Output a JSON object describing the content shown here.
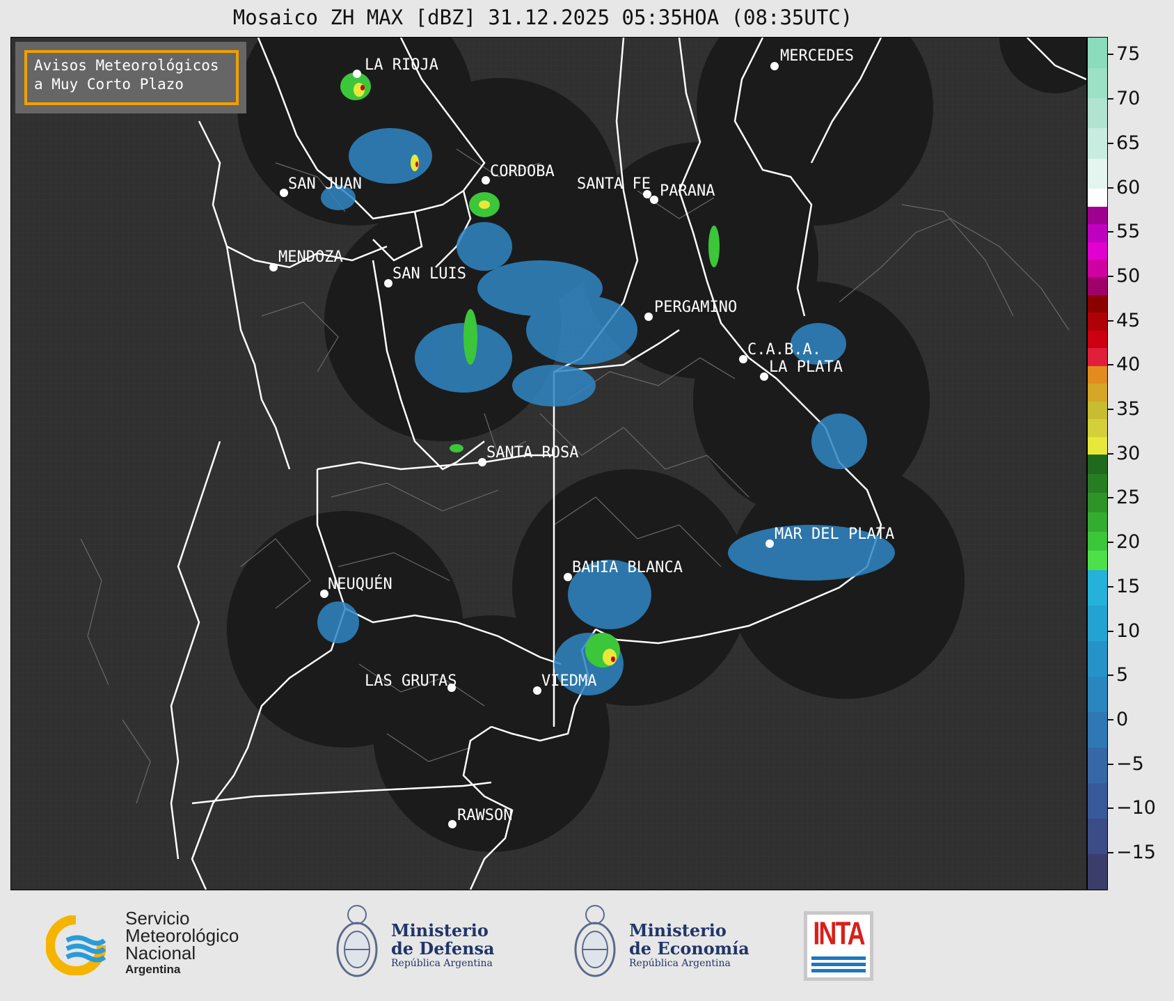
{
  "title": "Mosaico ZH MAX [dBZ] 31.12.2025 05:35HOA (08:35UTC)",
  "avisos": {
    "line1": "Avisos Meteorológicos",
    "line2": "a Muy Corto Plazo",
    "border_color": "#f0a000"
  },
  "cities": [
    {
      "name": "LA RIOJA"
    },
    {
      "name": "MERCEDES"
    },
    {
      "name": "SAN JUAN"
    },
    {
      "name": "CORDOBA"
    },
    {
      "name": "SANTA FE"
    },
    {
      "name": "PARANA"
    },
    {
      "name": "MENDOZA"
    },
    {
      "name": "SAN LUIS"
    },
    {
      "name": "PERGAMINO"
    },
    {
      "name": "C.A.B.A."
    },
    {
      "name": "LA PLATA"
    },
    {
      "name": "SANTA ROSA"
    },
    {
      "name": "MAR DEL PLATA"
    },
    {
      "name": "BAHIA BLANCA"
    },
    {
      "name": "NEUQUÉN"
    },
    {
      "name": "LAS GRUTAS"
    },
    {
      "name": "VIEDMA"
    },
    {
      "name": "RAWSON"
    }
  ],
  "colorbar": {
    "unit": "dBZ",
    "min": -19,
    "max": 77,
    "tick_labels": [
      "75",
      "70",
      "65",
      "60",
      "55",
      "50",
      "45",
      "40",
      "35",
      "30",
      "25",
      "20",
      "15",
      "10",
      "5",
      "0",
      "−5",
      "−10",
      "−15"
    ],
    "tick_values": [
      75,
      70,
      65,
      60,
      55,
      50,
      45,
      40,
      35,
      30,
      25,
      20,
      15,
      10,
      5,
      0,
      -5,
      -10,
      -15
    ],
    "segments": [
      {
        "from": -19,
        "to": 17,
        "colors": [
          "#3b3e6b",
          "#3c4c86",
          "#395a99",
          "#3668a8",
          "#2f78b4",
          "#2a86bf",
          "#2693c8",
          "#23a3d2",
          "#24b2da"
        ]
      },
      {
        "from": 17,
        "to": 30,
        "colors": [
          "#4ee04a",
          "#3cc63a",
          "#34ac30",
          "#2e9428",
          "#277e22",
          "#1f6a1c"
        ]
      },
      {
        "from": 30,
        "to": 40,
        "colors": [
          "#e8e83a",
          "#d4d03a",
          "#c8bc30",
          "#d6a626",
          "#e28c1e"
        ]
      },
      {
        "from": 40,
        "to": 50,
        "colors": [
          "#e0203a",
          "#cc0010",
          "#b00008",
          "#8c0000",
          "#a0006a"
        ]
      },
      {
        "from": 50,
        "to": 58,
        "colors": [
          "#d000a0",
          "#e000d0",
          "#c000c0",
          "#a00090"
        ]
      },
      {
        "from": 58,
        "to": 60,
        "colors": [
          "#ffffff"
        ]
      },
      {
        "from": 60,
        "to": 77,
        "colors": [
          "#e4f4ee",
          "#c8ecdf",
          "#b0e4d0",
          "#9ce0c6",
          "#8adcbc"
        ]
      }
    ]
  },
  "logos": {
    "smn": {
      "line1": "Servicio",
      "line2": "Meteorológico",
      "line3": "Nacional",
      "line4": "Argentina"
    },
    "defensa": {
      "line1": "Ministerio",
      "line2": "de Defensa",
      "line3": "República Argentina"
    },
    "economia": {
      "line1": "Ministerio",
      "line2": "de Economía",
      "line3": "República Argentina"
    },
    "inta": {
      "text": "INTA"
    }
  },
  "colors": {
    "map_background": "#303030",
    "radar_coverage": "#1b1b1b",
    "province_border": "#ffffff",
    "department_border": "#6a6a6a",
    "weak_echo": "#2f86c4",
    "moderate_echo": "#3cc63a"
  }
}
